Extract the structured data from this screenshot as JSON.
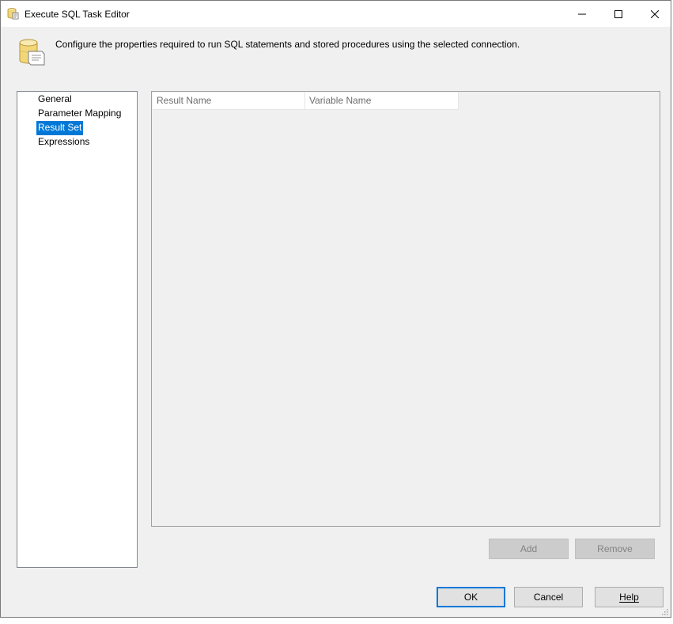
{
  "window": {
    "title": "Execute SQL Task Editor",
    "icon": "sql-task-icon"
  },
  "title_buttons": {
    "minimize_icon": "minimize-icon",
    "maximize_icon": "maximize-icon",
    "close_icon": "close-icon"
  },
  "header": {
    "icon": "database-scroll-icon",
    "description": "Configure the properties required to run SQL statements and stored procedures using the selected connection."
  },
  "nav": {
    "items": [
      {
        "label": "General",
        "selected": false
      },
      {
        "label": "Parameter Mapping",
        "selected": false
      },
      {
        "label": "Result Set",
        "selected": true
      },
      {
        "label": "Expressions",
        "selected": false
      }
    ]
  },
  "grid": {
    "columns": [
      "Result Name",
      "Variable Name"
    ],
    "rows": []
  },
  "grid_buttons": {
    "add_label": "Add",
    "remove_label": "Remove"
  },
  "dialog_buttons": {
    "ok_label": "OK",
    "cancel_label": "Cancel",
    "help_label": "Help"
  },
  "colors": {
    "selection": "#0078d7",
    "window_bg": "#f0f0f0",
    "default_button_border": "#0078d7"
  }
}
